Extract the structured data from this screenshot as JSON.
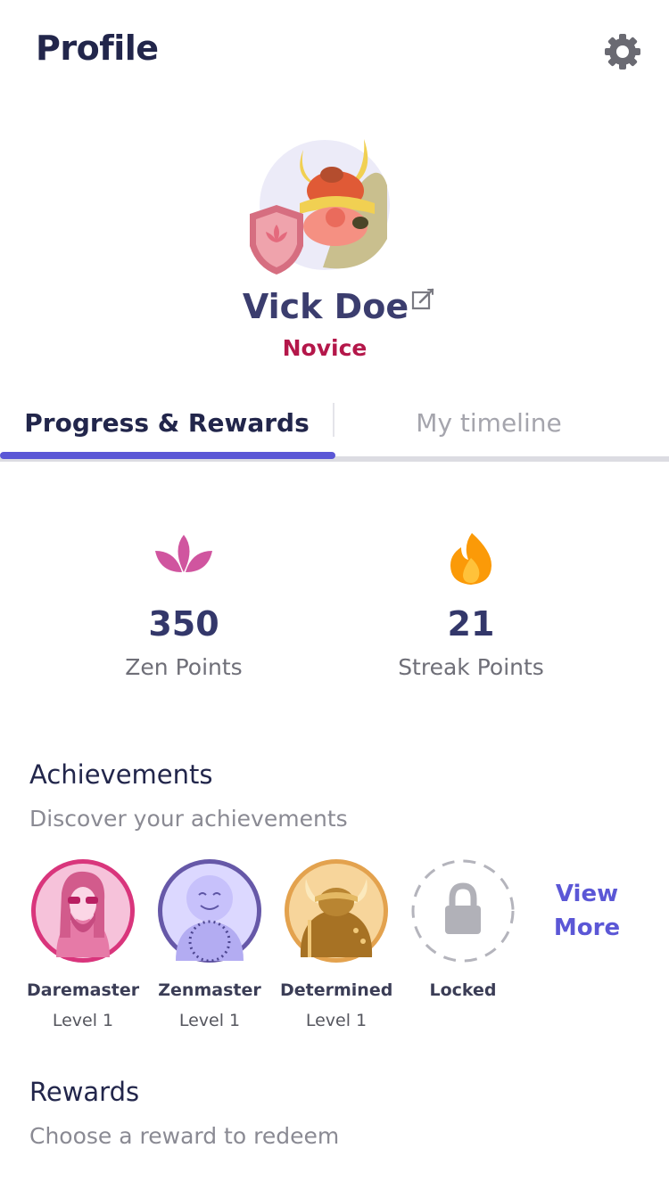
{
  "header": {
    "title": "Profile",
    "settings_icon": "gear-icon"
  },
  "profile": {
    "name": "Vick Doe",
    "rank": "Novice",
    "edit_icon": "edit-icon"
  },
  "tabs": [
    {
      "label": "Progress & Rewards",
      "active": true
    },
    {
      "label": "My timeline",
      "active": false
    }
  ],
  "stats": {
    "zen": {
      "value": "350",
      "label": "Zen Points",
      "icon": "lotus-icon"
    },
    "streak": {
      "value": "21",
      "label": "Streak Points",
      "icon": "flame-icon"
    }
  },
  "achievements": {
    "title": "Achievements",
    "subtitle": "Discover your achievements",
    "items": [
      {
        "name": "Daremaster",
        "level": "Level 1",
        "icon": "daremaster-badge"
      },
      {
        "name": "Zenmaster",
        "level": "Level 1",
        "icon": "zenmaster-badge"
      },
      {
        "name": "Determined",
        "level": "Level 1",
        "icon": "determined-badge"
      },
      {
        "name": "Locked",
        "level": "",
        "icon": "lock-icon"
      }
    ],
    "view_more": "View More"
  },
  "rewards": {
    "title": "Rewards",
    "subtitle": "Choose a reward to redeem"
  },
  "colors": {
    "accent": "#5b57d6",
    "rank": "#b4174a",
    "zen_icon": "#d0559f",
    "streak_icon": "#fb9a08"
  }
}
